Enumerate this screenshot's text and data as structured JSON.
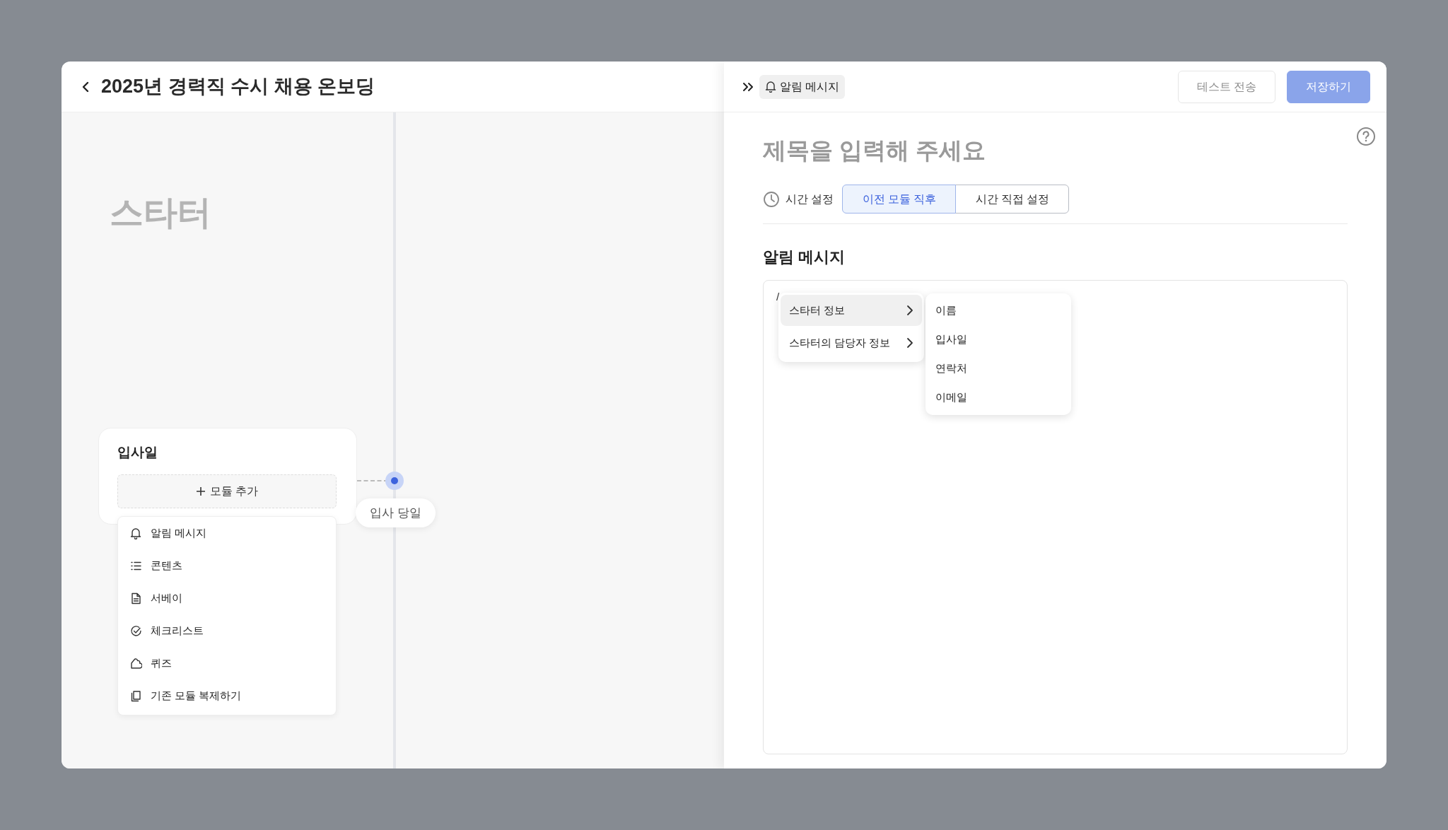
{
  "page_title": "2025년 경력직 수시 채용 온보딩",
  "canvas": {
    "lane_title": "스타터",
    "stage": {
      "title": "입사일",
      "add_button": "모듈 추가"
    },
    "module_menu": [
      {
        "kind": "bell",
        "label": "알림 메시지"
      },
      {
        "kind": "list",
        "label": "콘텐츠"
      },
      {
        "kind": "document",
        "label": "서베이"
      },
      {
        "kind": "check",
        "label": "체크리스트"
      },
      {
        "kind": "puzzle",
        "label": "퀴즈"
      },
      {
        "kind": "copy",
        "label": "기존 모듈 복제하기"
      }
    ],
    "timeline_marker": {
      "label": "입사 당일"
    }
  },
  "panel": {
    "chip": "알림 메시지",
    "buttons": [
      {
        "kind": "outline",
        "label": "테스트 전송",
        "disabled": true
      },
      {
        "kind": "primary",
        "label": "저장하기",
        "disabled": true
      }
    ],
    "title_placeholder": "제목을 입력해 주세요",
    "time_setting": {
      "label": "시간 설정",
      "options": [
        {
          "label": "이전 모듈 직후",
          "selected": true
        },
        {
          "label": "시간 직접 설정",
          "selected": false
        }
      ]
    },
    "section_title": "알림 메시지",
    "editor": {
      "value": "/"
    },
    "variable_menu": [
      {
        "label": "스타터 정보",
        "selected": true
      },
      {
        "label": "스타터의 담당자 정보",
        "selected": false
      }
    ],
    "submenu": [
      "이름",
      "입사일",
      "연락처",
      "이메일"
    ]
  }
}
